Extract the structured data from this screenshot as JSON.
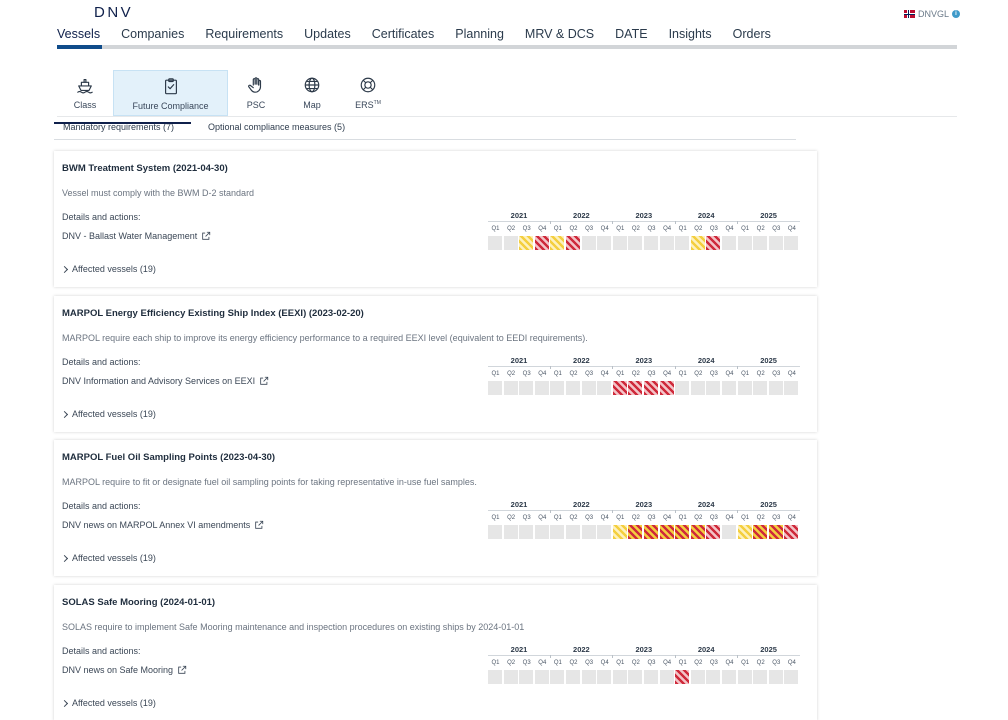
{
  "header": {
    "logo": "DNV",
    "user": "DNVGL",
    "info_icon": "info-icon"
  },
  "nav": [
    "Vessels",
    "Companies",
    "Requirements",
    "Updates",
    "Certificates",
    "Planning",
    "MRV & DCS",
    "DATE",
    "Insights",
    "Orders"
  ],
  "tools": [
    {
      "label": "Class",
      "icon": "ship-icon"
    },
    {
      "label": "Future Compliance",
      "icon": "clipboard-check-icon"
    },
    {
      "label": "PSC",
      "icon": "hand-icon"
    },
    {
      "label": "Map",
      "icon": "globe-icon"
    },
    {
      "label": "ERS",
      "sup": "TM",
      "icon": "lifebuoy-icon"
    }
  ],
  "subtabs": {
    "mandatory": "Mandatory requirements (7)",
    "optional": "Optional compliance measures (5)"
  },
  "timeline": {
    "years": [
      "2021",
      "2022",
      "2023",
      "2024",
      "2025"
    ],
    "quarters": [
      "Q1",
      "Q2",
      "Q3",
      "Q4"
    ]
  },
  "colors": {
    "yellow": "#f4cf3f",
    "red": "#cf2a3b",
    "empty": "#e6e6e6",
    "accent": "#0f204b"
  },
  "cards": [
    {
      "title": "BWM Treatment System (2021-04-30)",
      "desc": "Vessel must comply with the BWM D-2 standard",
      "details_label": "Details and actions:",
      "link": "DNV - Ballast Water Management",
      "affected": "Affected vessels (19)",
      "cells": [
        "empty",
        "empty",
        "yellow",
        "red",
        "yellow",
        "red",
        "empty",
        "empty",
        "empty",
        "empty",
        "empty",
        "empty",
        "empty",
        "yellow",
        "red",
        "empty",
        "empty",
        "empty",
        "empty",
        "empty"
      ]
    },
    {
      "title": "MARPOL Energy Efficiency Existing Ship Index (EEXI) (2023-02-20)",
      "desc": "MARPOL require each ship to improve its energy efficiency performance to a required EEXI level (equivalent to EEDI requirements).",
      "details_label": "Details and actions:",
      "link": "DNV Information and Advisory Services on EEXI",
      "affected": "Affected vessels (19)",
      "cells": [
        "empty",
        "empty",
        "empty",
        "empty",
        "empty",
        "empty",
        "empty",
        "empty",
        "red",
        "red",
        "red",
        "red",
        "empty",
        "empty",
        "empty",
        "empty",
        "empty",
        "empty",
        "empty",
        "empty"
      ]
    },
    {
      "title": "MARPOL Fuel Oil Sampling Points (2023-04-30)",
      "desc": "MARPOL require to fit or designate fuel oil sampling points for taking representative in-use fuel samples.",
      "details_label": "Details and actions:",
      "link": "DNV news on MARPOL Annex VI amendments",
      "affected": "Affected vessels (19)",
      "cells": [
        "empty",
        "empty",
        "empty",
        "empty",
        "empty",
        "empty",
        "empty",
        "empty",
        "yellow",
        "orange",
        "orange",
        "orange",
        "orange",
        "orange",
        "red",
        "empty",
        "yellow",
        "orange",
        "orange",
        "red"
      ]
    },
    {
      "title": "SOLAS Safe Mooring (2024-01-01)",
      "desc": "SOLAS require to implement Safe Mooring maintenance and inspection procedures on existing ships by 2024-01-01",
      "details_label": "Details and actions:",
      "link": "DNV news on Safe Mooring",
      "affected": "Affected vessels (19)",
      "cells": [
        "empty",
        "empty",
        "empty",
        "empty",
        "empty",
        "empty",
        "empty",
        "empty",
        "empty",
        "empty",
        "empty",
        "empty",
        "red",
        "empty",
        "empty",
        "empty",
        "empty",
        "empty",
        "empty",
        "empty"
      ]
    }
  ]
}
